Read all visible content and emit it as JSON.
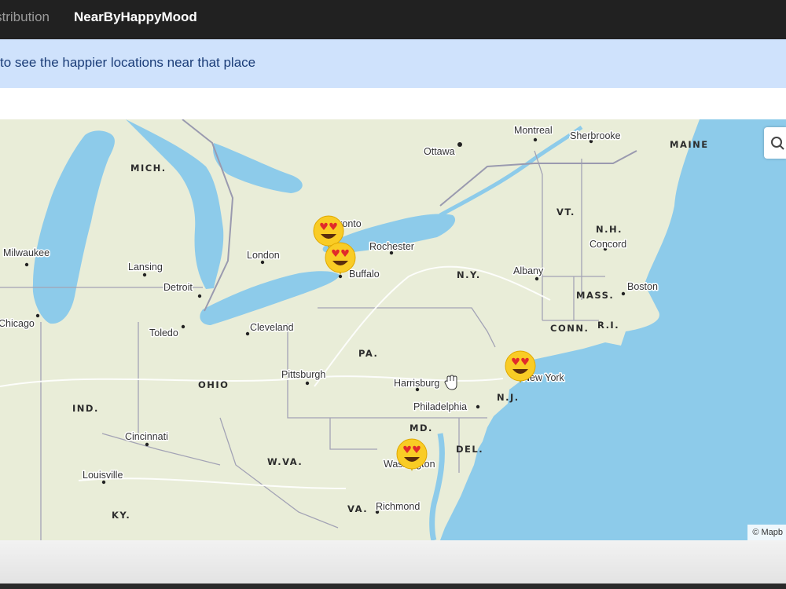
{
  "nav": {
    "partial_link": "stribution",
    "active_link": "NearByHappyMood"
  },
  "banner": {
    "text": "to see the happier locations near that place"
  },
  "map": {
    "attribution": "© Mapb",
    "search_icon": "search-icon",
    "colors": {
      "water": "#8dcbea",
      "land": "#e9edd8",
      "border": "#a3a3b5",
      "road": "#ffffff"
    },
    "regions": [
      "MICH.",
      "MAINE",
      "VT.",
      "N.H.",
      "N.Y.",
      "MASS.",
      "CONN.",
      "R.I.",
      "PA.",
      "OHIO",
      "IND.",
      "N.J.",
      "MD.",
      "DEL.",
      "W.VA.",
      "VA.",
      "KY."
    ],
    "cities": [
      "Montreal",
      "Sherbrooke",
      "Ottawa",
      "Toronto",
      "Rochester",
      "Buffalo",
      "Albany",
      "Concord",
      "Boston",
      "Milwaukee",
      "Lansing",
      "London",
      "Detroit",
      "Chicago",
      "Toledo",
      "Cleveland",
      "Pittsburgh",
      "Harrisburg",
      "New York",
      "Philadelphia",
      "Cincinnati",
      "Louisville",
      "Washington",
      "Richmond"
    ],
    "markers": [
      {
        "name": "Toronto",
        "emoji": "😍"
      },
      {
        "name": "Buffalo",
        "emoji": "😍"
      },
      {
        "name": "New York",
        "emoji": "😍"
      },
      {
        "name": "Washington",
        "emoji": "😍"
      }
    ]
  }
}
